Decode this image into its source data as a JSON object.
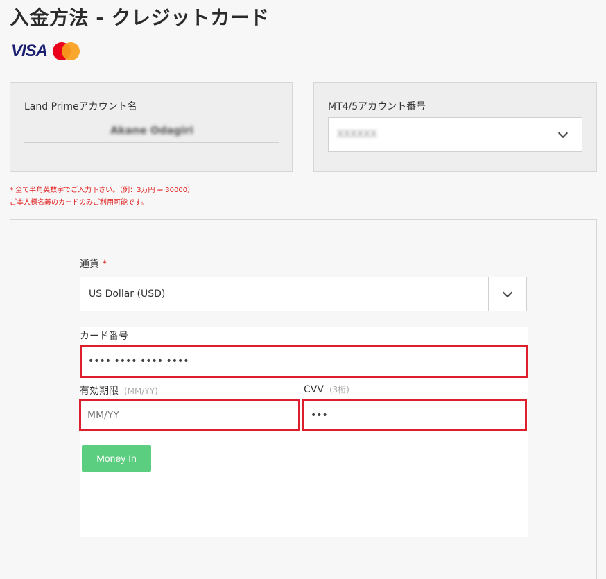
{
  "page": {
    "title": "入金方法 - クレジットカード"
  },
  "brand": {
    "visa": "VISA",
    "mastercard_colors": [
      "#eb001b",
      "#f79e1b"
    ]
  },
  "account_panel": {
    "label": "Land Primeアカウント名",
    "name_blurred": "Akane Odagiri"
  },
  "mt_panel": {
    "label": "MT4/5アカウント番号",
    "selected_value_blurred": "XXXXXX"
  },
  "notes": {
    "line1": "* 全て半角英数字でご入力下さい。（例：3万円 ⇒ 30000）",
    "line2": "ご本人様名義のカードのみご利用可能です。"
  },
  "form": {
    "currency": {
      "label": "通貨",
      "required_mark": "*",
      "value": "US Dollar (USD)"
    },
    "card_number": {
      "label": "カード番号",
      "value": "•••• •••• •••• ••••"
    },
    "expiry": {
      "label": "有効期限",
      "hint": "(MM/YY)",
      "placeholder": "MM/YY"
    },
    "cvv": {
      "label": "CVV",
      "hint": "(3桁)",
      "value": "•••"
    },
    "submit_label": "Money In"
  },
  "colors": {
    "highlight_border": "#dc1e2d",
    "submit_button": "#5cce7f",
    "note_text": "#e02020"
  }
}
